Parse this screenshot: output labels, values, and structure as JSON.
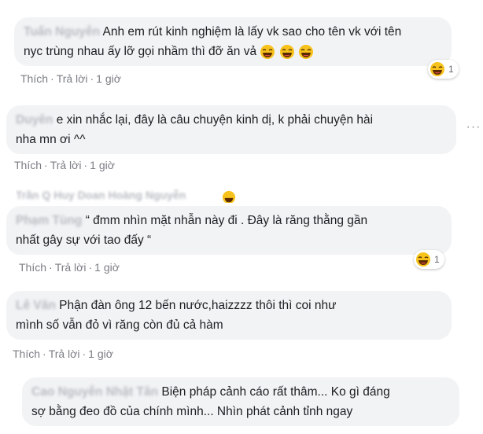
{
  "comments": [
    {
      "author": "Tuấn Nguyễn",
      "text_line1": "Anh em rút kinh nghiệm là lấy vk sao cho tên vk với tên",
      "text_line2": "nyc trùng nhau ấy lỡ gọi nhầm thì đỡ ăn vả",
      "like": "Thích",
      "reply": "Trả lời",
      "time": "1 giờ",
      "reaction_icon": "laughing-face-icon",
      "reaction_count": "1"
    },
    {
      "author": "Duyên",
      "text_line1": "e xin nhắc lại, đây là câu chuyện kinh dị, k phải chuyện hài",
      "text_line2": "nha mn ơi ^^",
      "like": "Thích",
      "reply": "Trả lời",
      "time": "1 giờ"
    },
    {
      "author": "Trần Q Huy Doan Hoàng Nguyễn"
    },
    {
      "author": "Phạm Tùng",
      "text_line1": "“ đmm nhìn mặt nhẫn này đi . Đây là răng thằng gần",
      "text_line2": "nhất gây sự với tao đấy “",
      "like": "Thích",
      "reply": "Trả lời",
      "time": "1 giờ",
      "reaction_icon": "laughing-face-icon",
      "reaction_count": "1"
    },
    {
      "author": "Lê Văn",
      "text_line1": "Phận đàn ông 12 bến nước,haizzzz thôi thì coi như",
      "text_line2": "mình số vẫn đỏ vì răng còn đủ cả hàm",
      "like": "Thích",
      "reply": "Trả lời",
      "time": "1 giờ"
    },
    {
      "author": "Cao Nguyễn Nhật Tân",
      "text_line1": "Biện pháp cảnh cáo rất thâm... Ko gì đáng",
      "text_line2": "sợ bằng đeo đồ của chính mình... Nhìn phát cảnh tỉnh ngay"
    }
  ],
  "colors": {
    "bubble": "#f2f3f5",
    "action_text": "#7a7d84",
    "text": "#1c1e21"
  }
}
